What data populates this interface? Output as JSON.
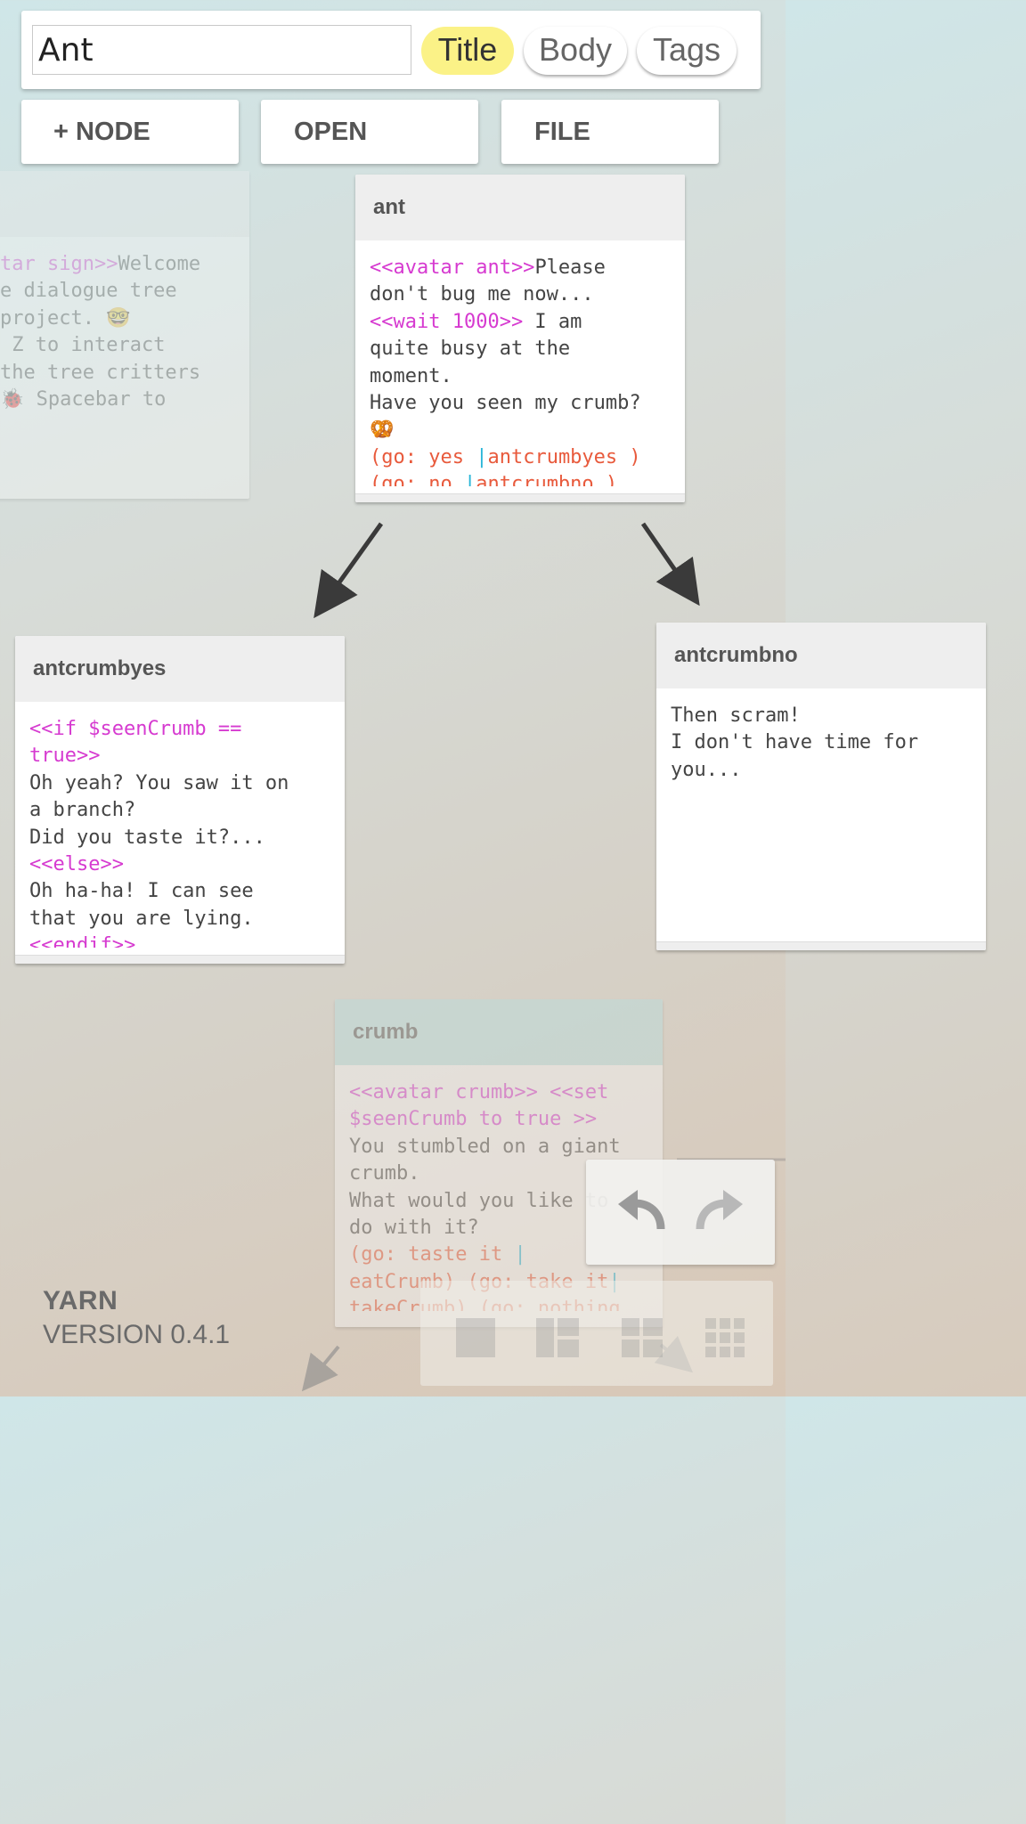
{
  "search": {
    "value": "Ant",
    "filters": [
      {
        "label": "Title",
        "active": true
      },
      {
        "label": "Body",
        "active": false
      },
      {
        "label": "Tags",
        "active": false
      }
    ]
  },
  "toolbar": {
    "add_node_label": "+ NODE",
    "open_label": "OPEN",
    "file_label": "FILE"
  },
  "nodes": {
    "welcome": {
      "title": "",
      "lines": [
        [
          {
            "t": "tar sign>>",
            "c": "kw"
          },
          {
            "t": "Welcome"
          }
        ],
        [
          {
            "t": "e dialogue tree"
          }
        ],
        [
          {
            "t": "project. 🤓"
          }
        ],
        [
          {
            "t": " Z to interact"
          }
        ],
        [
          {
            "t": "the tree critters"
          }
        ],
        [
          {
            "t": "🐞 Spacebar to"
          }
        ]
      ]
    },
    "ant": {
      "title": "ant",
      "lines": [
        [
          {
            "t": "<<avatar ant>>",
            "c": "kw"
          },
          {
            "t": "Please"
          }
        ],
        [
          {
            "t": "don't bug me now..."
          }
        ],
        [
          {
            "t": "<<wait 1000>>",
            "c": "kw"
          },
          {
            "t": " I am"
          }
        ],
        [
          {
            "t": "quite busy at the"
          }
        ],
        [
          {
            "t": "moment."
          }
        ],
        [
          {
            "t": "Have you seen my crumb?"
          }
        ],
        [
          {
            "t": "🥨"
          }
        ],
        [
          {
            "t": "(go: yes ",
            "c": "go"
          },
          {
            "t": "|",
            "c": "sep"
          },
          {
            "t": "antcrumbyes )",
            "c": "go"
          }
        ],
        [
          {
            "t": "(go: no ",
            "c": "go"
          },
          {
            "t": "|",
            "c": "sep"
          },
          {
            "t": "antcrumbno )",
            "c": "go"
          }
        ]
      ]
    },
    "antcrumbyes": {
      "title": "antcrumbyes",
      "lines": [
        [
          {
            "t": "<<if $seenCrumb ==",
            "c": "kw"
          }
        ],
        [
          {
            "t": "true>>",
            "c": "kw"
          }
        ],
        [
          {
            "t": "Oh yeah? You saw it on"
          }
        ],
        [
          {
            "t": "a branch?"
          }
        ],
        [
          {
            "t": "Did you taste it?..."
          }
        ],
        [
          {
            "t": "<<else>>",
            "c": "kw"
          }
        ],
        [
          {
            "t": "Oh ha-ha! I can see"
          }
        ],
        [
          {
            "t": "that you are lying."
          }
        ],
        [
          {
            "t": "<<endif>>",
            "c": "kw"
          }
        ]
      ]
    },
    "antcrumbno": {
      "title": "antcrumbno",
      "lines": [
        [
          {
            "t": "Then scram!"
          }
        ],
        [
          {
            "t": "I don't have time for"
          }
        ],
        [
          {
            "t": "you..."
          }
        ]
      ]
    },
    "crumb": {
      "title": "crumb",
      "lines": [
        [
          {
            "t": "<<avatar crumb>> <<set",
            "c": "kw"
          }
        ],
        [
          {
            "t": "$seenCrumb to true >>",
            "c": "kw"
          }
        ],
        [
          {
            "t": "You stumbled on a giant"
          }
        ],
        [
          {
            "t": "crumb."
          }
        ],
        [
          {
            "t": "What would you like to"
          }
        ],
        [
          {
            "t": "do with it?"
          }
        ],
        [
          {
            "t": "(go: taste it ",
            "c": "go"
          },
          {
            "t": "|",
            "c": "sep"
          }
        ],
        [
          {
            "t": "eatCrumb) (go: take it",
            "c": "go"
          },
          {
            "t": "|",
            "c": "sep"
          }
        ],
        [
          {
            "t": "takeCrumb) (go: nothing",
            "c": "go"
          }
        ]
      ]
    }
  },
  "icons": {
    "undo": "undo-icon",
    "redo": "redo-icon"
  },
  "brand": {
    "name": "YARN",
    "version": "VERSION 0.4.1"
  }
}
